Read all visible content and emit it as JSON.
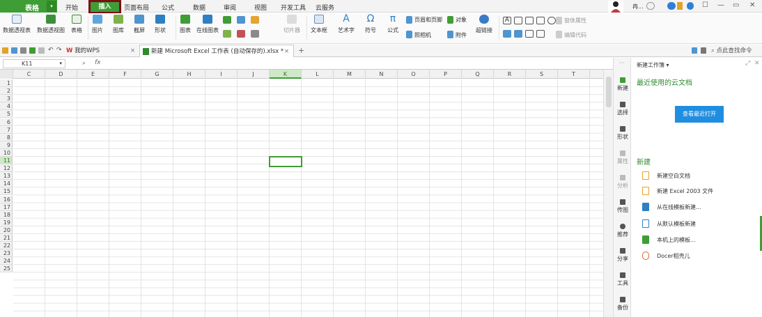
{
  "menubar": {
    "app_name": "表格",
    "tabs": [
      "开始",
      "插入",
      "页面布局",
      "公式",
      "数据",
      "审阅",
      "视图",
      "开发工具",
      "云服务"
    ],
    "active_tab": "插入",
    "user_name": "冉...",
    "window_controls": [
      "☐",
      "—",
      "▭",
      "✕"
    ]
  },
  "ribbon": {
    "large_buttons": [
      "数据透视表",
      "数据透视图",
      "表格",
      "图片",
      "图库",
      "截屏",
      "形状",
      "图表",
      "在线图表",
      "切片器",
      "文本框",
      "艺术字",
      "符号",
      "公式",
      "照相机",
      "附件",
      "超链接"
    ],
    "small_items": [
      "页眉和页脚",
      "对象",
      "窗体属性",
      "编辑代码"
    ]
  },
  "doc_tabs": {
    "home_tab": "我的WPS",
    "file_tab": "新建 Microsoft Excel 工作表 (自动保存的).xlsx *",
    "new_tab_symbol": "+",
    "close_symbol": "×",
    "search_label": "点此查找命令"
  },
  "formula_bar": {
    "name_box": "K11",
    "fx_label": "fx",
    "value": ""
  },
  "sheet": {
    "columns": [
      "C",
      "D",
      "E",
      "F",
      "G",
      "H",
      "I",
      "J",
      "K",
      "L",
      "M",
      "N",
      "O",
      "P",
      "Q",
      "R",
      "S",
      "T"
    ],
    "rows": [
      "1",
      "2",
      "3",
      "4",
      "5",
      "6",
      "7",
      "8",
      "9",
      "10",
      "11",
      "12",
      "13",
      "14",
      "15",
      "16",
      "17",
      "18",
      "19",
      "20",
      "21",
      "22",
      "23",
      "24",
      "25"
    ],
    "selected_column": "K",
    "selected_row": "11"
  },
  "side_toolbar": {
    "items": [
      "新建",
      "选择",
      "形状",
      "属性",
      "分析",
      "传图",
      "推荐",
      "分享",
      "工具",
      "备份"
    ]
  },
  "task_panel": {
    "header": "新建工作簿 ▾",
    "recent_title": "最近使用的云文档",
    "recent_button": "查看最近打开",
    "new_title": "新建",
    "new_items": [
      "新建空白文档",
      "新建 Excel 2003 文件",
      "从在线模板新建...",
      "从默认模板新建",
      "本机上的模板...",
      "Docer稻壳儿"
    ]
  },
  "colors": {
    "accent_green": "#3f9d35",
    "insert_tab_border": "#7b0f13",
    "button_blue": "#1f8ee0"
  }
}
